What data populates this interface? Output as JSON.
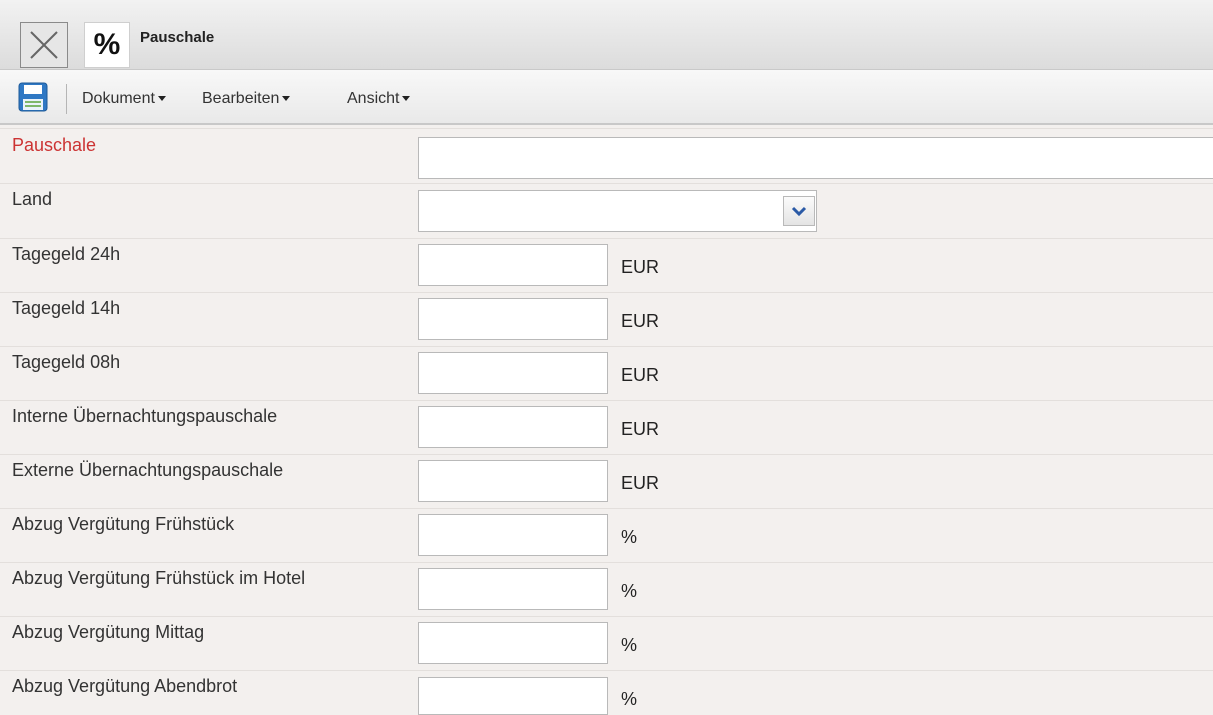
{
  "window": {
    "title": "Pauschale",
    "close_icon": "close-icon",
    "type_icon_text": "%"
  },
  "toolbar": {
    "save_icon": "save-icon",
    "menus": [
      "Dokument",
      "Bearbeiten",
      "Ansicht"
    ]
  },
  "form": {
    "pauschale": {
      "label": "Pauschale",
      "value": "",
      "required": true
    },
    "land": {
      "label": "Land",
      "value": ""
    },
    "fields": [
      {
        "label": "Tagegeld 24h",
        "value": "",
        "unit": "EUR"
      },
      {
        "label": "Tagegeld 14h",
        "value": "",
        "unit": "EUR"
      },
      {
        "label": "Tagegeld 08h",
        "value": "",
        "unit": "EUR"
      },
      {
        "label": "Interne Übernachtungspauschale",
        "value": "",
        "unit": "EUR"
      },
      {
        "label": "Externe Übernachtungspauschale",
        "value": "",
        "unit": "EUR"
      },
      {
        "label": "Abzug Vergütung Frühstück",
        "value": "",
        "unit": "%"
      },
      {
        "label": "Abzug Vergütung Frühstück im Hotel",
        "value": "",
        "unit": "%"
      },
      {
        "label": "Abzug Vergütung Mittag",
        "value": "",
        "unit": "%"
      },
      {
        "label": "Abzug Vergütung Abendbrot",
        "value": "",
        "unit": "%"
      }
    ]
  },
  "colors": {
    "required_label": "#cc3333",
    "background": "#f3f0ee"
  }
}
